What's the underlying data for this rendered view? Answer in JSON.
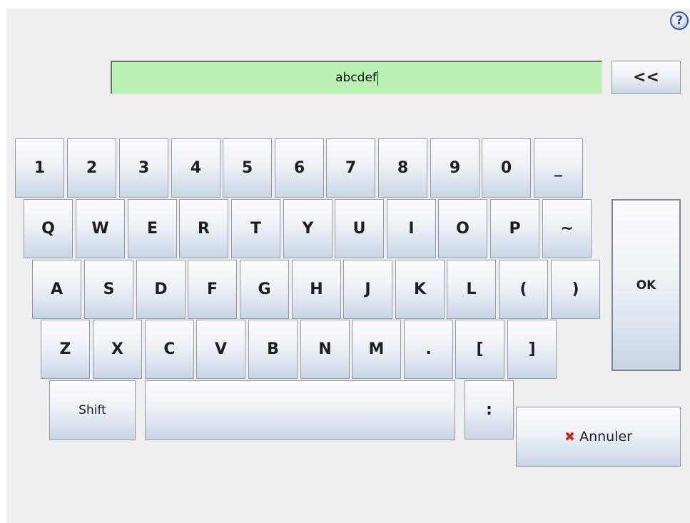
{
  "help": {
    "symbol": "?"
  },
  "input": {
    "value": "abcdef"
  },
  "backspace": {
    "label": "<<"
  },
  "keyboard": {
    "row1": [
      "1",
      "2",
      "3",
      "4",
      "5",
      "6",
      "7",
      "8",
      "9",
      "0",
      "_"
    ],
    "row2": [
      "Q",
      "W",
      "E",
      "R",
      "T",
      "Y",
      "U",
      "I",
      "O",
      "P",
      "~"
    ],
    "row3": [
      "A",
      "S",
      "D",
      "F",
      "G",
      "H",
      "J",
      "K",
      "L",
      "(",
      ")"
    ],
    "row4": [
      "Z",
      "X",
      "C",
      "V",
      "B",
      "N",
      "M",
      ".",
      "[",
      "]"
    ],
    "shift_label": "Shift",
    "space_label": "",
    "colon_label": ":"
  },
  "ok": {
    "label": "OK"
  },
  "cancel": {
    "icon": "close-icon",
    "label": "Annuler",
    "icon_color": "#c42a16"
  },
  "colors": {
    "field_bg": "#b9f0b4",
    "panel_bg": "#efefef"
  }
}
